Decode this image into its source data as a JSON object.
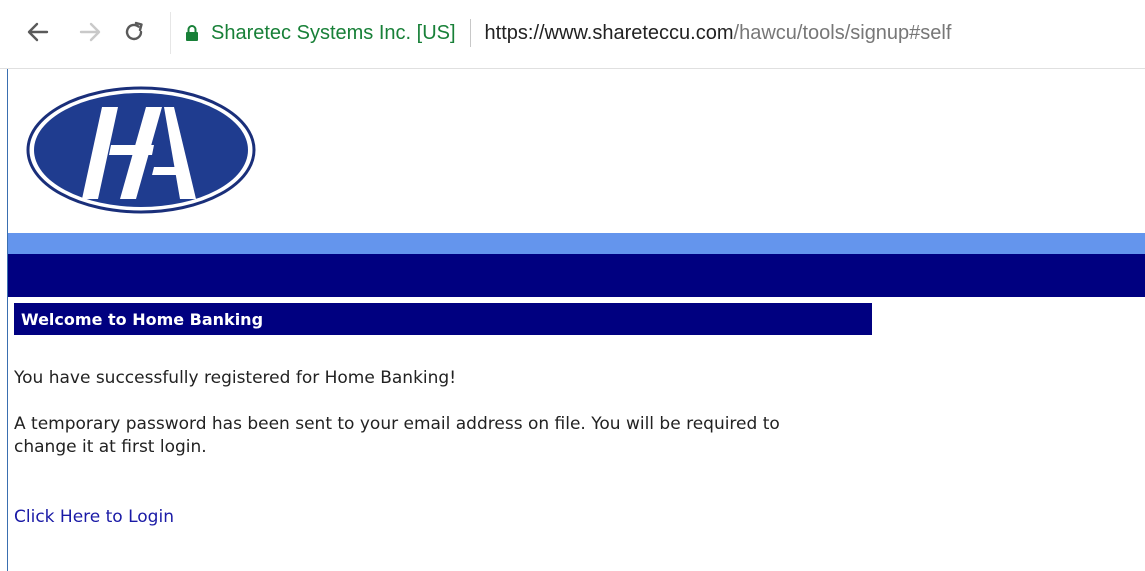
{
  "browser": {
    "back_icon": "arrow-left-icon",
    "forward_icon": "arrow-right-icon",
    "reload_icon": "reload-icon",
    "lock_icon": "lock-icon",
    "site_identity": "Sharetec Systems Inc. [US]",
    "url_host": "https://www.shareteccu.com",
    "url_path": "/hawcu/tools/signup#self",
    "secure_color": "#188038"
  },
  "page": {
    "logo_icon": "ha-oval-logo",
    "brand_colors": {
      "light_band": "#6495ed",
      "dark_band": "#000080"
    },
    "welcome_title": "Welcome to Home Banking",
    "success_message": "You have successfully registered for Home Banking!",
    "temp_password_message": "A temporary password has been sent to your email address on file. You will be required to change it at first login.",
    "login_link": "Click Here to Login"
  }
}
